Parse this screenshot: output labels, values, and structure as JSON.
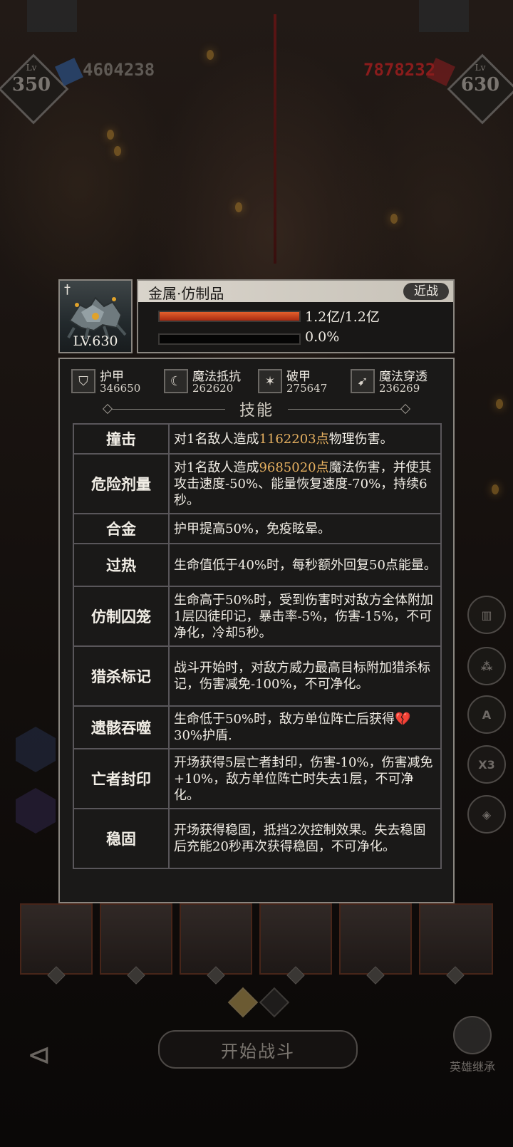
{
  "hud": {
    "left_level": "350",
    "left_level_tag": "Lv",
    "left_power": "4604238",
    "right_level": "630",
    "right_level_tag": "Lv",
    "right_power": "7878232"
  },
  "side_buttons": [
    "▥",
    "⁂",
    "A",
    "X3",
    "◈"
  ],
  "bottom": {
    "start_label": "开始战斗",
    "inherit_label": "英雄继承",
    "back_icon": "back-arrow-icon"
  },
  "unit": {
    "name": "金属·仿制品",
    "type_badge": "近战",
    "level": "LV.630",
    "hp_text": "1.2亿/1.2亿",
    "hp_ratio": 1.0,
    "energy_text": "0.0%",
    "energy_ratio": 0.0
  },
  "stats": [
    {
      "name": "护甲",
      "value": "346650",
      "icon": "armor-icon"
    },
    {
      "name": "魔法抵抗",
      "value": "262620",
      "icon": "magic-resist-icon"
    },
    {
      "name": "破甲",
      "value": "275647",
      "icon": "armor-break-icon"
    },
    {
      "name": "魔法穿透",
      "value": "236269",
      "icon": "magic-penetration-icon"
    }
  ],
  "skills_title": "技能",
  "skills": [
    {
      "name": "撞击",
      "pre": "对1名敌人造成",
      "hl": "1162203点",
      "post": "物理伤害。"
    },
    {
      "name": "危险剂量",
      "pre": "对1名敌人造成",
      "hl": "9685020点",
      "post": "魔法伤害，并使其攻击速度-50%、能量恢复速度-70%，持续6秒。"
    },
    {
      "name": "合金",
      "pre": "护甲提高50%，免疫眩晕。",
      "hl": "",
      "post": ""
    },
    {
      "name": "过热",
      "pre": "生命值低于40%时，每秒额外回复50点能量。",
      "hl": "",
      "post": ""
    },
    {
      "name": "仿制囚笼",
      "pre": "生命高于50%时，受到伤害时对敌方全体附加1层囚徒印记，暴击率-5%，伤害-15%，不可净化，冷却5秒。",
      "hl": "",
      "post": ""
    },
    {
      "name": "猎杀标记",
      "pre": "战斗开始时，对敌方威力最高目标附加猎杀标记，伤害减免-100%，不可净化。",
      "hl": "",
      "post": ""
    },
    {
      "name": "遗骸吞噬",
      "pre": "生命低于50%时，敌方单位阵亡后获得",
      "heart": "💔",
      "hl": "",
      "post": "30%护盾."
    },
    {
      "name": "亡者封印",
      "pre": "开场获得5层亡者封印，伤害-10%，伤害减免+10%，敌方单位阵亡时失去1层，不可净化。",
      "hl": "",
      "post": ""
    },
    {
      "name": "稳固",
      "pre": "开场获得稳固，抵挡2次控制效果。失去稳固后充能20秒再次获得稳固，不可净化。",
      "hl": "",
      "post": ""
    }
  ],
  "colors": {
    "highlight": "#e6b060",
    "hp_fill": "#e4602c",
    "panel_border": "#8a8680",
    "right_power": "#8a1c1c",
    "left_power": "#5f5a55"
  }
}
